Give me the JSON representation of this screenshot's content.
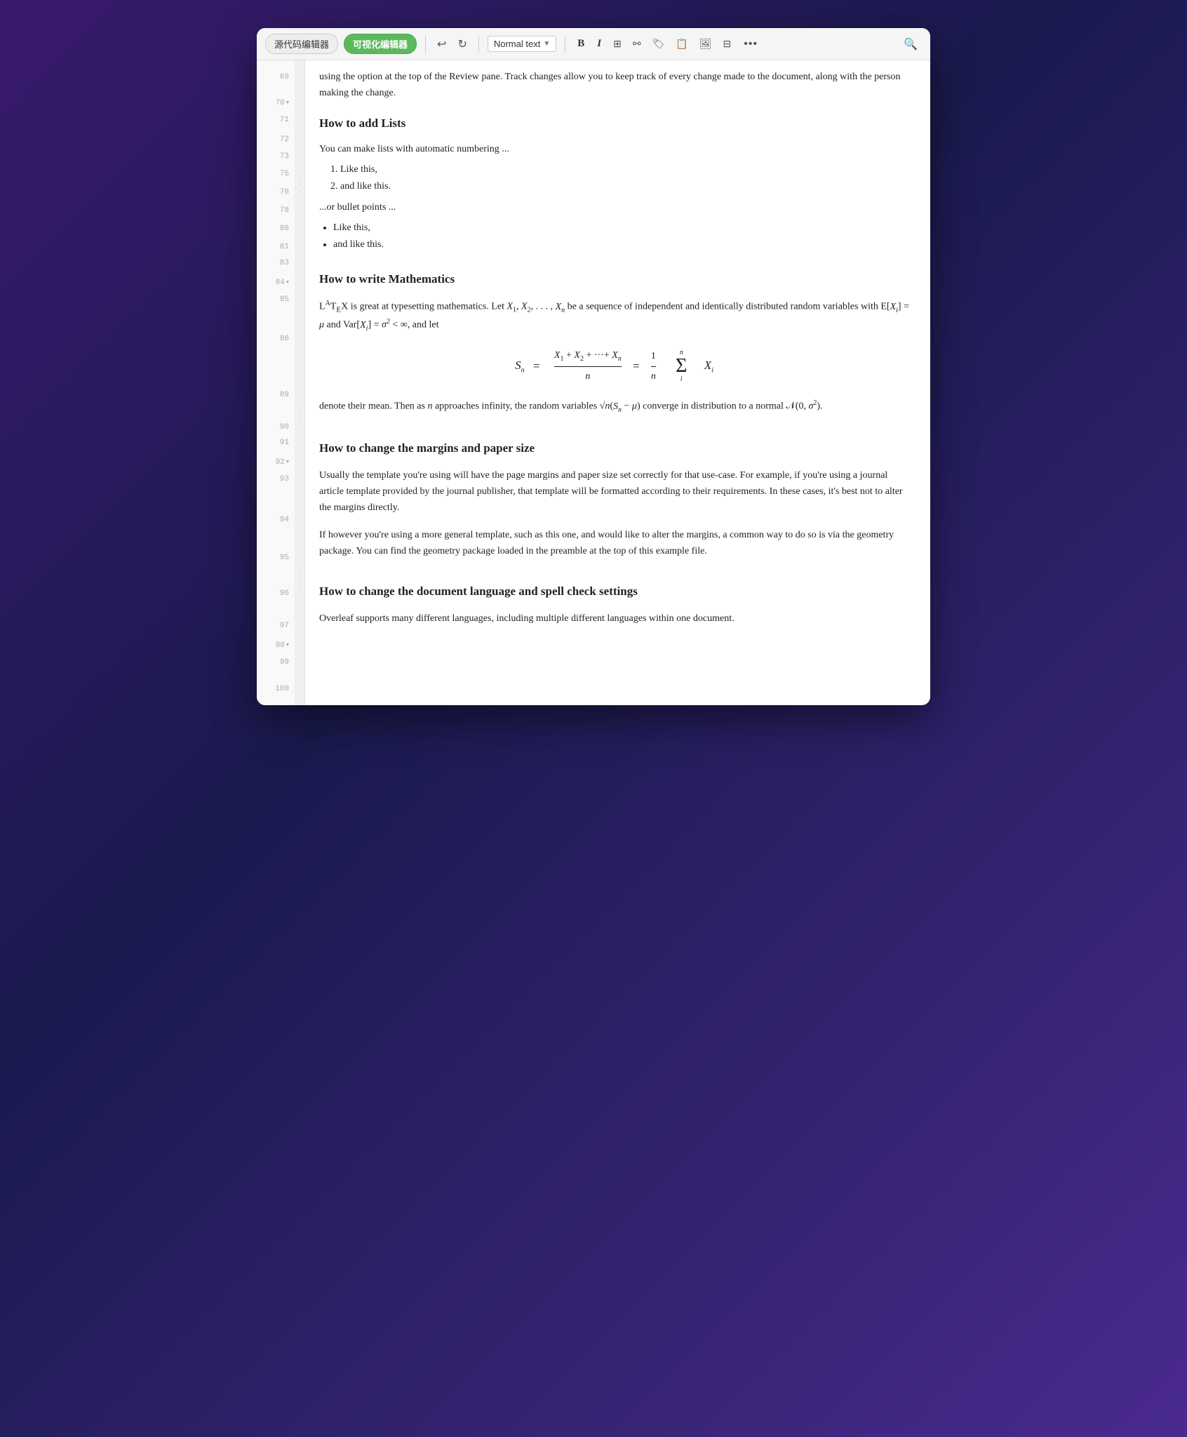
{
  "toolbar": {
    "tab_source": "源代码编辑器",
    "tab_visual": "可视化编辑器",
    "undo_label": "↩",
    "redo_label": "↻",
    "style_label": "Normal text",
    "style_chevron": "▼",
    "bold_label": "B",
    "italic_label": "I",
    "grid_icon": "⊞",
    "link_icon": "⚯",
    "tag_icon": "🏷",
    "clipboard_icon": "📋",
    "image_icon": "🖼",
    "table_icon": "⊟",
    "more_icon": "•••",
    "search_icon": "🔍"
  },
  "lines": {
    "numbers": [
      69,
      70,
      71,
      72,
      73,
      75,
      76,
      78,
      80,
      81,
      83,
      84,
      85,
      86,
      89,
      90,
      91,
      92,
      93,
      94,
      95,
      96,
      97,
      98,
      99,
      100
    ]
  },
  "content": {
    "intro": "using the option at the top of the Review pane. Track changes allow you to keep track of every change made to the document, along with the person making the change.",
    "section_lists_heading": "How to add Lists",
    "lists_intro": "You can make lists with automatic numbering ...",
    "ordered_items": [
      "Like this,",
      "and like this."
    ],
    "bullet_intro": "...or bullet points ...",
    "bullet_items": [
      "Like this,",
      "and like this."
    ],
    "section_math_heading": "How to write Mathematics",
    "math_intro": "LATEX is great at typesetting mathematics. Let X₁, X₂, ..., Xₙ be a sequence of independent and identically distributed random variables with E[Xᵢ] = μ and Var[Xᵢ] = σ² < ∞, and let",
    "math_formula_left": "Sₙ =",
    "math_formula_numerator": "X₁ + X₂ + ··· + Xₙ",
    "math_formula_denominator": "n",
    "math_formula_equals": "=",
    "math_formula_oneover": "1",
    "math_formula_n": "n",
    "math_formula_sigma": "Σ",
    "math_formula_super": "n",
    "math_formula_sub": "i",
    "math_formula_xi": "Xᵢ",
    "math_outro": "denote their mean. Then as n approaches infinity, the random variables √n(Sₙ − μ) converge in distribution to a normal 𝒩(0, σ²).",
    "section_margins_heading": "How to change the margins and paper size",
    "margins_para1": "Usually the template you're using will have the page margins and paper size set correctly for that use-case. For example, if you're using a journal article template provided by the journal publisher, that template will be formatted according to their requirements. In these cases, it's best not to alter the margins directly.",
    "margins_para2": "If however you're using a more general template, such as this one, and would like to alter the margins, a common way to do so is via the geometry package. You can find the geometry package loaded in the preamble at the top of this example file.",
    "section_language_heading": "How to change the document language and spell check settings",
    "language_para1": "Overleaf supports many different languages, including multiple different languages within one document."
  }
}
